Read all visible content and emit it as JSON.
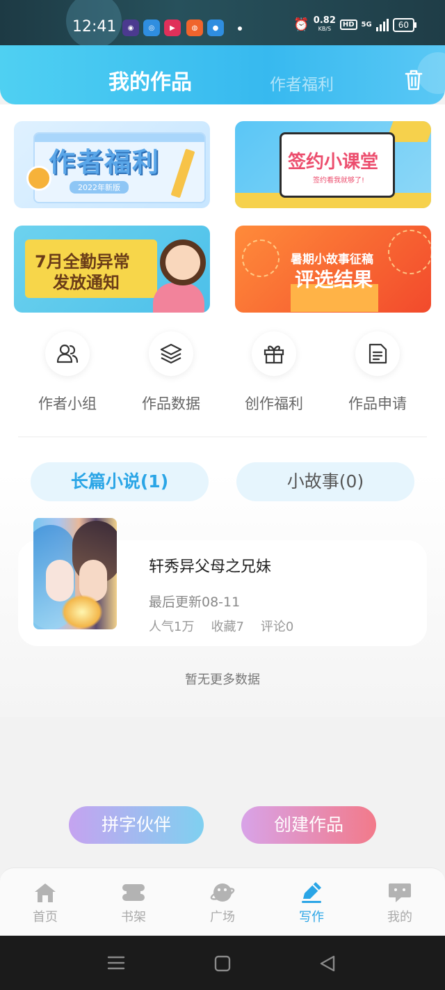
{
  "status_bar": {
    "time": "12:41",
    "net_speed": "0.82",
    "net_unit": "KB/S",
    "hd": "HD",
    "network": "5G",
    "battery": "60"
  },
  "header": {
    "active_tab": "我的作品",
    "other_tab": "作者福利",
    "trash_icon": "trash-icon"
  },
  "banners": [
    {
      "title": "作者福利",
      "subtitle": "2022年新版"
    },
    {
      "title": "签约小课堂",
      "subtitle": "签约看我就够了!"
    },
    {
      "title_line1": "7月全勤异常",
      "title_line2": "发放通知"
    },
    {
      "title_line1": "暑期小故事征稿",
      "title_line2": "评选结果"
    }
  ],
  "menu": [
    {
      "label": "作者小组",
      "icon": "users-icon"
    },
    {
      "label": "作品数据",
      "icon": "layers-icon"
    },
    {
      "label": "创作福利",
      "icon": "gift-icon"
    },
    {
      "label": "作品申请",
      "icon": "document-icon"
    }
  ],
  "categories": {
    "long": "长篇小说(1)",
    "short": "小故事(0)"
  },
  "work": {
    "title": "轩秀异父母之兄妹",
    "updated": "最后更新08-11",
    "popularity": "人气1万",
    "favorites": "收藏7",
    "comments": "评论0"
  },
  "no_more": "暂无更多数据",
  "actions": {
    "partner": "拼字伙伴",
    "create": "创建作品"
  },
  "tabs": [
    {
      "label": "首页",
      "icon": "home-icon"
    },
    {
      "label": "书架",
      "icon": "bookshelf-icon"
    },
    {
      "label": "广场",
      "icon": "planet-icon"
    },
    {
      "label": "写作",
      "icon": "pen-icon"
    },
    {
      "label": "我的",
      "icon": "chat-face-icon"
    }
  ],
  "colors": {
    "accent": "#2aa5e6",
    "header_start": "#4fd0f2",
    "header_end": "#37b9ef"
  }
}
